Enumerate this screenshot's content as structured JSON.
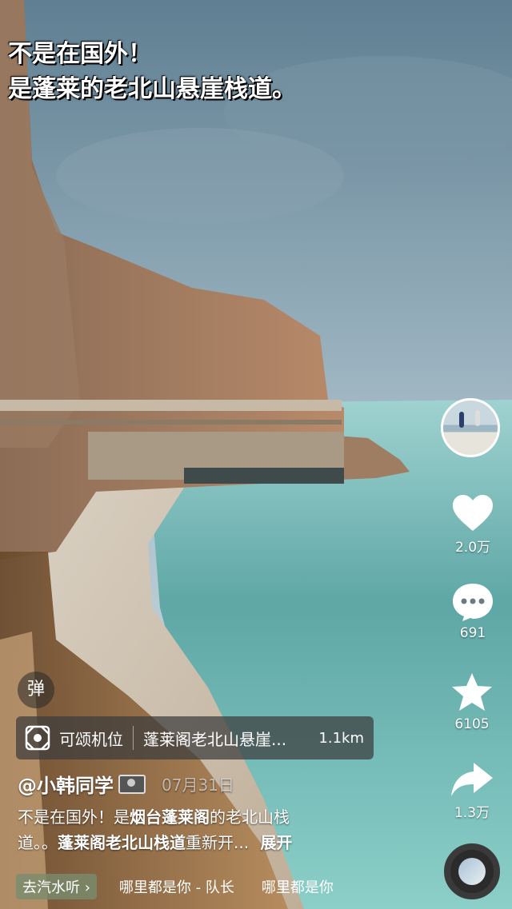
{
  "overlay": {
    "line1": "不是在国外！",
    "line2": "是蓬莱的老北山悬崖栈道。"
  },
  "actions": {
    "like_count": "2.0万",
    "comment_count": "691",
    "favorite_count": "6105",
    "share_count": "1.3万"
  },
  "danmu_label": "弹",
  "location": {
    "label": "可颂机位",
    "name": "蓬莱阁老北山悬崖...",
    "distance": "1.1km"
  },
  "author": {
    "handle": "@小韩同学",
    "date": "07月31日"
  },
  "description": {
    "text1": "不是在国外！是",
    "tag1": "烟台蓬莱阁",
    "text2": "的老北山栈",
    "text3": "道。。",
    "tag2": "蓬莱阁老北山栈道",
    "text4": "重新开...",
    "expand": "展开"
  },
  "music": {
    "tag": "去汽水听",
    "title": "哪里都是你 - 队长",
    "title_repeat": "哪里都是你"
  },
  "colors": {
    "sky": "#8aa6b6",
    "sea": "#6fb8b6",
    "cliff": "#a77d5f"
  }
}
